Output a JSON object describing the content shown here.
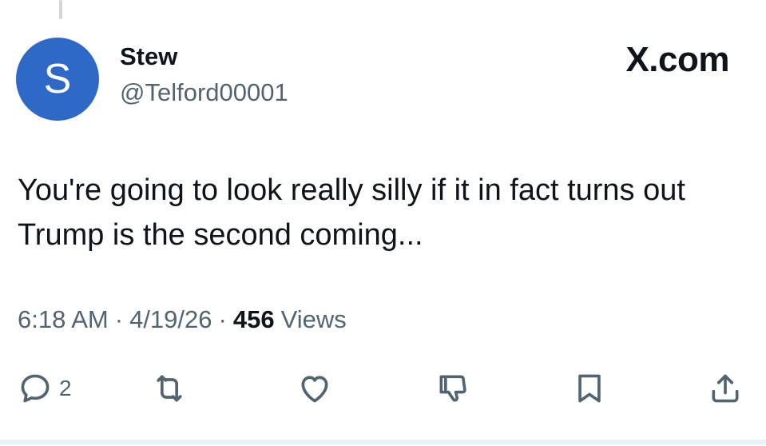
{
  "author": {
    "avatar_letter": "S",
    "display_name": "Stew",
    "handle": "@Telford00001"
  },
  "brand": "X.com",
  "tweet": {
    "text": "You're going to look really silly if it in fact turns out Trump is the second coming..."
  },
  "meta": {
    "time": "6:18 AM",
    "sep1": "·",
    "date": "4/19/26",
    "sep2": "·",
    "views_count": "456",
    "views_label": "Views"
  },
  "actions": {
    "reply_count": "2"
  },
  "icons": {
    "reply": "reply-icon",
    "retweet": "retweet-icon",
    "like": "heart-icon",
    "dislike": "thumbs-down-icon",
    "bookmark": "bookmark-icon",
    "share": "share-icon"
  },
  "colors": {
    "avatar": "#2f69c7",
    "secondary_text": "#536471",
    "primary_text": "#0f1419"
  }
}
